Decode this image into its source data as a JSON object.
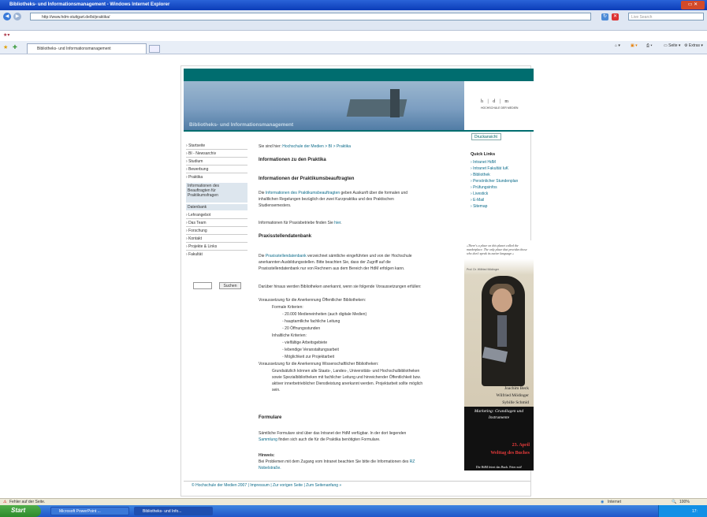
{
  "window": {
    "title": "Bibliotheks- und Informationsmanagement - Windows Internet Explorer"
  },
  "browser": {
    "url": "http://www.hdm-stuttgart.de/bi/praktika/",
    "search_placeholder": "Live Search",
    "tab_title": "Bibliotheks- und Informationsmanagement",
    "tools": {
      "page": "Seite",
      "extras": "Extras"
    }
  },
  "site": {
    "banner_title": "Bibliotheks- und Informationsmanagement",
    "logo_main": "h | d | m",
    "logo_sub": "HOCHSCHULE DER MEDIEN",
    "print_label": "Druckansicht"
  },
  "sidebar": {
    "items": [
      "Startseite",
      "BI - Newsarchiv",
      "Studium",
      "Bewerbung",
      "Praktika"
    ],
    "subitems": [
      "Informationen des",
      "Beauftragten für",
      "Praktikumsfragen"
    ],
    "subitem2": "Datenbank",
    "items2": [
      "Lehrangebot",
      "Das Team",
      "Forschung",
      "Kontakt",
      "Projekte & Links",
      "Fakultät"
    ],
    "search_button": "Suchen"
  },
  "main": {
    "breadcrumb_prefix": "Sie sind hier:",
    "breadcrumb": "Hochschule der Medien > BI > Praktika",
    "h1": "Informationen zu den Praktika",
    "h2": "Informationen der Praktikumsbeauftragten",
    "p1a": "Die",
    "p1link": "Informationen des Praktikumsbeauftragten",
    "p1b": "geben Auskunft über die formalen und",
    "p1c": "inhaltlichen Regelungen bezüglich der zwei Kurzpraktika und des Praktischen",
    "p1d": "Studiensemesters.",
    "p2a": "Informationen für Praxisbetriebe finden Sie",
    "p2link": "hier",
    "h3": "Praxisstellendatenbank",
    "p3a": "Die",
    "p3link": "Praxisstellendatenbank",
    "p3b": "verzeichnet sämtliche eingeführten und von der Hochschule",
    "p3c": "anerkannten Ausbildungsstellen. Bitte beachten Sie, dass der Zugriff auf die",
    "p3d": "Praxisstellendatenbank nur von Rechnern aus dem Bereich der HdM erfolgen kann.",
    "p4": "Darüber hinaus werden Bibliotheken anerkannt, wenn sie folgende Voraussetzungen erfüllen:",
    "v1": "Voraussetzung für die Anerkennung Öffentlicher Bibliotheken:",
    "f1": "Formale Kriterien:",
    "f1items": [
      "20.000 Medieneinheiten (auch digitale Medien)",
      "hauptamtliche fachliche Leitung",
      "20 Öffnungsstunden"
    ],
    "f2": "Inhaltliche Kriterien:",
    "f2items": [
      "vielfältige Arbeitsgebiete",
      "lebendige Veranstaltungsarbeit",
      "Möglichkeit zur Projektarbeit"
    ],
    "v2": "Voraussetzung für die Anerkennung Wissenschaftlicher Bibliotheken:",
    "v2a": "Grundsätzlich können alle Staats-, Landes-, Universitäts- und Hochschulbibliotheken",
    "v2b": "sowie Spezialbibliotheken mit fachlicher Leitung und hinreichender Öffentlichkeit bzw.",
    "v2c": "aktiver innerbetrieblicher Dienstleistung anerkannt werden. Projektarbeit sollte möglich",
    "v2d": "sein.",
    "h4": "Formulare",
    "p5a": "Sämtliche Formulare sind über das Intranet der HdM verfügbar. In der dort liegenden",
    "p5link": "Sammlung",
    "p5b": "finden sich auch die für die Praktika benötigten Formulare.",
    "h5": "Hinweis:",
    "p6a": "Bei Problemen mit dem Zugang vom Intranet beachten Sie bitte die Informationen des",
    "p6link": "RZ",
    "p6b": "Nobelstraße."
  },
  "quicklinks": {
    "title": "Quick Links",
    "items": [
      "Intranet HdM",
      "Intranet Fakultät IuK",
      "Bibliothek",
      "Persönlicher Stundenplan",
      "Prüfungsinfos",
      "Livestick",
      "E-Mail",
      "Sitemap"
    ]
  },
  "ad": {
    "quote": "»There's a place on this planet called the marketplace. The only place that provides those who don't speak its native language.«",
    "quote_author": "Prof. Dr. Wilfried Mödinger",
    "authors": [
      "Joachim Beck",
      "Wilfried Mödinger",
      "Sybille Schmid"
    ],
    "book_title1": "Marketing: Grundlagen und",
    "book_title2": "Instrumente",
    "date": "23. April",
    "event": "Welttag des Buches",
    "bottom": "Die HdM feiert das Buch. Feier mit!"
  },
  "footer": {
    "text": "Hochschule der Medien 2007 | Impressum | Zur vorigen Seite | Zum Seitenanfang"
  },
  "status": {
    "left": "Fehler auf der Seite.",
    "zone": "Internet",
    "zoom": "100%"
  },
  "taskbar": {
    "start": "Start",
    "buttons": [
      "Microsoft PowerPoint ...",
      "Bibliotheks- und Info..."
    ],
    "clock": "17:"
  }
}
